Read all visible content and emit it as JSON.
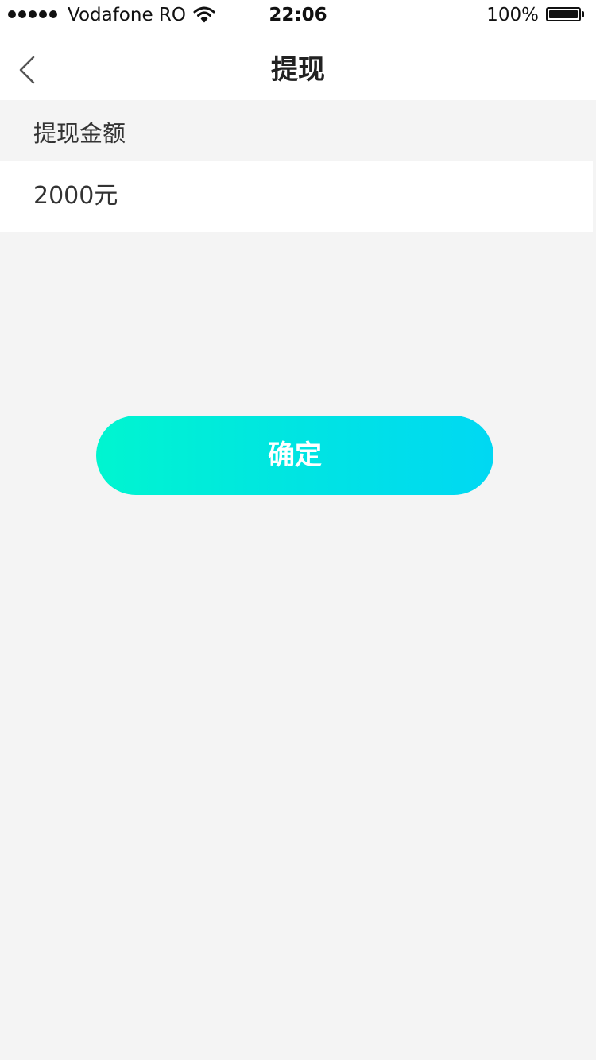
{
  "status_bar": {
    "carrier": "Vodafone RO",
    "time": "22:06",
    "battery_percent": "100%",
    "battery_level": 1.0,
    "signal_icon": "signal-dots-icon",
    "wifi_icon": "wifi-icon",
    "battery_icon": "battery-icon"
  },
  "nav": {
    "title": "提现",
    "back_icon": "chevron-left-icon"
  },
  "form": {
    "amount_label": "提现金额",
    "amount_value": "2000元"
  },
  "actions": {
    "confirm_label": "确定"
  },
  "colors": {
    "accent_start": "#00f5d0",
    "accent_end": "#00d8f3",
    "background": "#f4f4f4"
  }
}
